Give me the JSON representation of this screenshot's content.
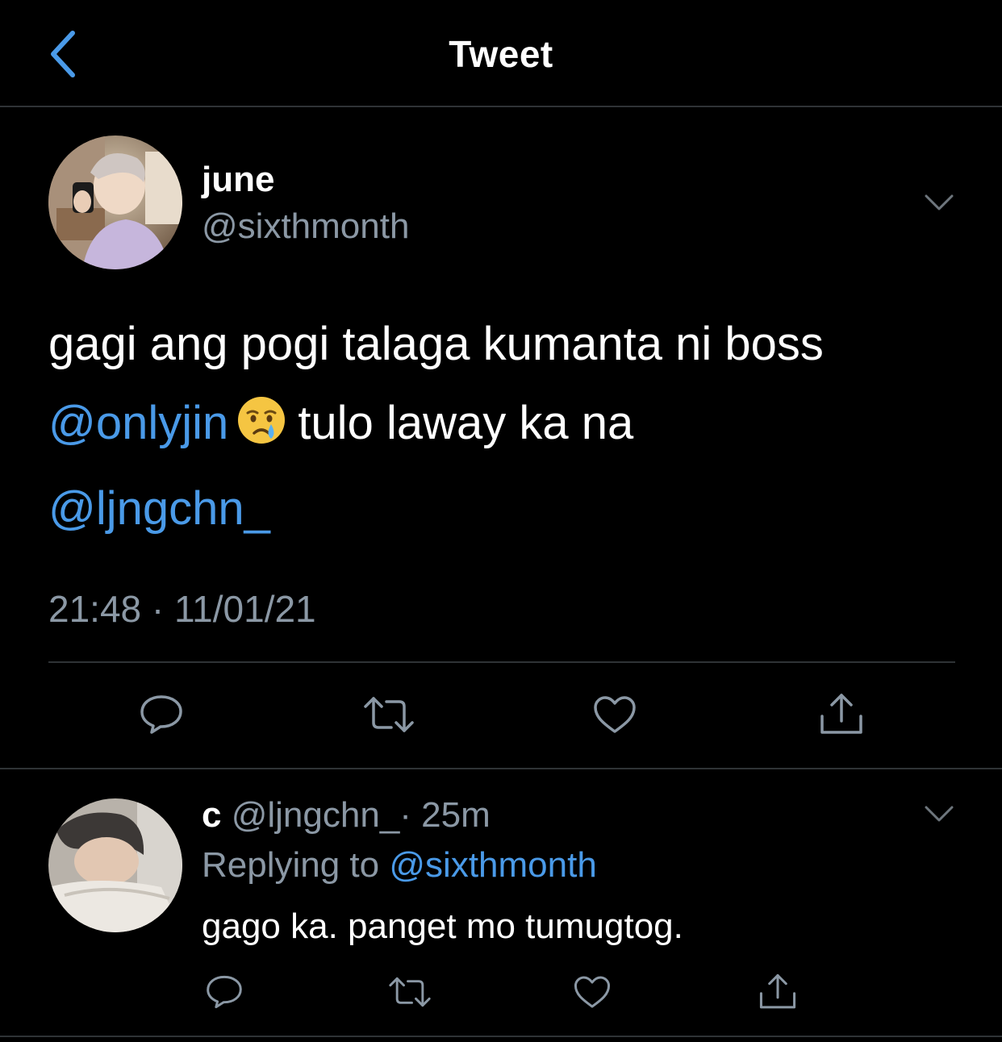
{
  "header": {
    "title": "Tweet",
    "back_icon": "chevron-left-icon"
  },
  "tweet": {
    "display_name": "june",
    "handle": "@sixthmonth",
    "text_part1": "gagi ang pogi talaga kumanta ni boss",
    "mention1": "@onlyjin",
    "emoji": "crying-face-emoji",
    "text_part2": "tulo laway ka na",
    "mention2": "@ljngchn_",
    "timestamp": "21:48 · 11/01/21",
    "actions": [
      "reply-icon",
      "retweet-icon",
      "like-icon",
      "share-icon"
    ]
  },
  "reply": {
    "display_name": "c",
    "handle": "@ljngchn_",
    "time": "· 25m",
    "replying_prefix": "Replying to",
    "replying_to": "@sixthmonth",
    "text": "gago ka. panget mo tumugtog."
  },
  "colors": {
    "background": "#000000",
    "accent": "#4a9ae8",
    "secondary_text": "#8b98a5",
    "divider": "#2f3336"
  }
}
